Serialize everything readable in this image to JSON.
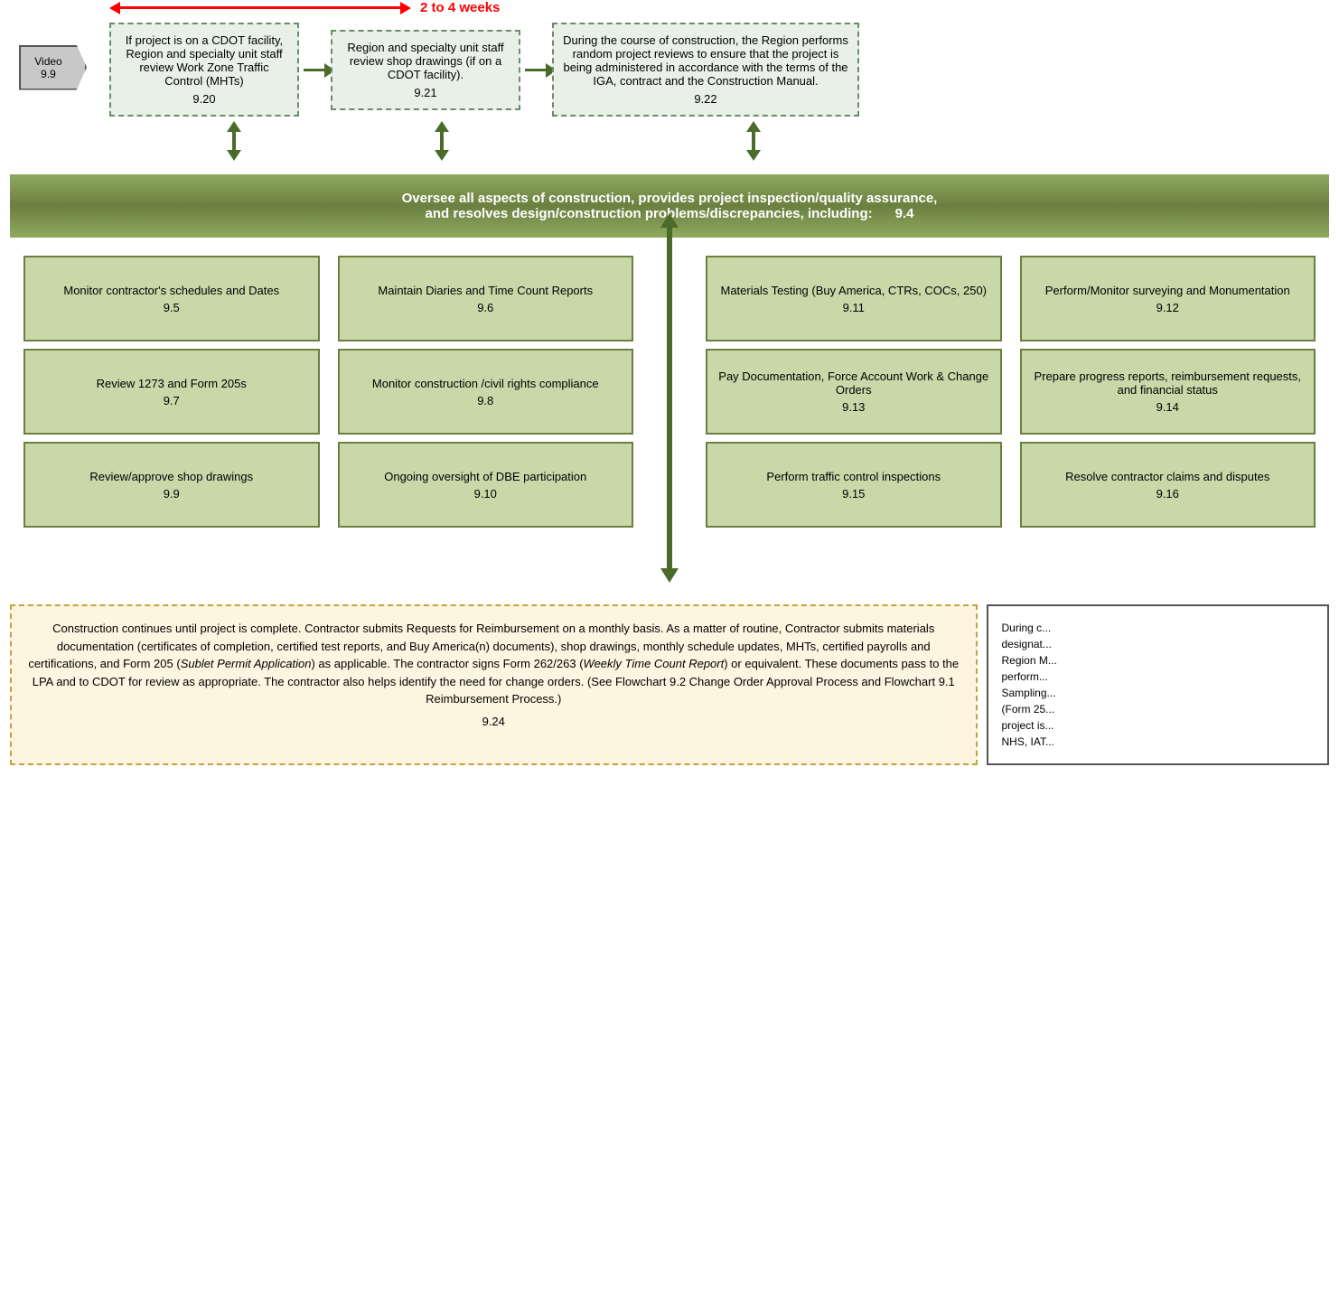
{
  "header": {
    "video_label": "Video",
    "video_number": "9.9",
    "weeks_label": "2 to 4 weeks"
  },
  "top_boxes": [
    {
      "id": "box-920",
      "text": "If project is on a CDOT facility, Region and specialty unit staff review Work Zone Traffic Control (MHTs)",
      "number": "9.20"
    },
    {
      "id": "box-921",
      "text": "Region and specialty unit staff  review shop drawings (if on a CDOT facility).",
      "number": "9.21"
    },
    {
      "id": "box-922",
      "text": "During the course of construction, the Region performs random project reviews to ensure that the project is being administered in accordance with the terms of the IGA, contract and the Construction Manual.",
      "number": "9.22"
    }
  ],
  "main_bar": {
    "text": "Oversee all aspects of construction, provides project  inspection/quality assurance,\nand resolves design/construction problems/discrepancies, including:",
    "number": "9.4"
  },
  "grid": {
    "columns": [
      {
        "boxes": [
          {
            "text": "Monitor contractor's schedules and Dates",
            "number": "9.5"
          },
          {
            "text": "Review 1273 and Form 205s",
            "number": "9.7"
          },
          {
            "text": "Review/approve shop drawings",
            "number": "9.9"
          }
        ]
      },
      {
        "boxes": [
          {
            "text": "Maintain Diaries and Time Count Reports",
            "number": "9.6"
          },
          {
            "text": "Monitor construction /civil rights compliance",
            "number": "9.8"
          },
          {
            "text": "Ongoing oversight of DBE participation",
            "number": "9.10"
          }
        ]
      },
      {
        "boxes": [
          {
            "text": "Materials Testing (Buy America, CTRs, COCs, 250)",
            "number": "9.11"
          },
          {
            "text": "Pay Documentation, Force Account Work & Change Orders",
            "number": "9.13"
          },
          {
            "text": "Perform traffic control inspections",
            "number": "9.15"
          }
        ]
      },
      {
        "boxes": [
          {
            "text": "Perform/Monitor surveying and Monumentation",
            "number": "9.12"
          },
          {
            "text": "Prepare progress reports, reimbursement requests, and financial status",
            "number": "9.14"
          },
          {
            "text": "Resolve contractor claims and disputes",
            "number": "9.16"
          }
        ]
      }
    ]
  },
  "bottom_left": {
    "text_parts": [
      "Construction continues until project is complete. Contractor submits Requests for Reimbursement on a monthly basis.   As a matter of routine, Contractor submits materials documentation (certificates of completion, certified test reports, and Buy America(n) documents), shop drawings, monthly schedule updates, MHTs, certified payrolls and certifications, and Form 205 (",
      "Sublet Permit Application",
      ") as applicable.  The contractor signs Form 262/263 (",
      "Weekly Time Count Report",
      ") or equivalent.  These documents pass to the LPA and to CDOT for review as appropriate.   The contractor also helps identify the need for change orders.  (See Flowchart 9.2 Change Order Approval Process and Flowchart 9.1 Reimbursement Process.)"
    ],
    "number": "9.24"
  },
  "bottom_right": {
    "text": "During c... designat... Region M... perform... Sampling... (Form 25... project is... NHS, IAT..."
  }
}
